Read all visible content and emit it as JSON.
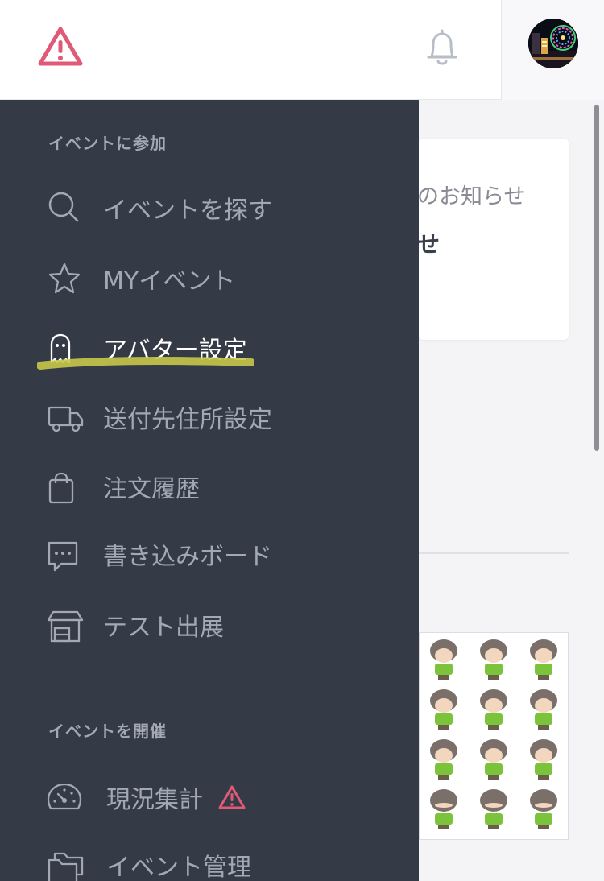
{
  "header": {
    "logo_icon": "warning-triangle-icon",
    "bell_icon": "bell-icon",
    "accent_color": "#e05a78"
  },
  "background": {
    "card_line1": "のお知らせ",
    "card_line2": "せ"
  },
  "drawer": {
    "section_join": "イベントに参加",
    "section_host": "イベントを開催",
    "items": [
      {
        "label": "イベントを探す",
        "icon": "search-icon"
      },
      {
        "label": "MYイベント",
        "icon": "star-icon"
      },
      {
        "label": "アバター設定",
        "icon": "ghost-icon",
        "active": true
      },
      {
        "label": "送付先住所設定",
        "icon": "truck-icon"
      },
      {
        "label": "注文履歴",
        "icon": "bag-icon"
      },
      {
        "label": "書き込みボード",
        "icon": "chat-icon"
      },
      {
        "label": "テスト出展",
        "icon": "store-icon"
      }
    ],
    "host_items": [
      {
        "label": "現況集計",
        "icon": "dashboard-icon",
        "badge": "warning-icon"
      },
      {
        "label": "イベント管理",
        "icon": "folder-icon"
      }
    ],
    "highlight_color": "#c8c84a"
  }
}
